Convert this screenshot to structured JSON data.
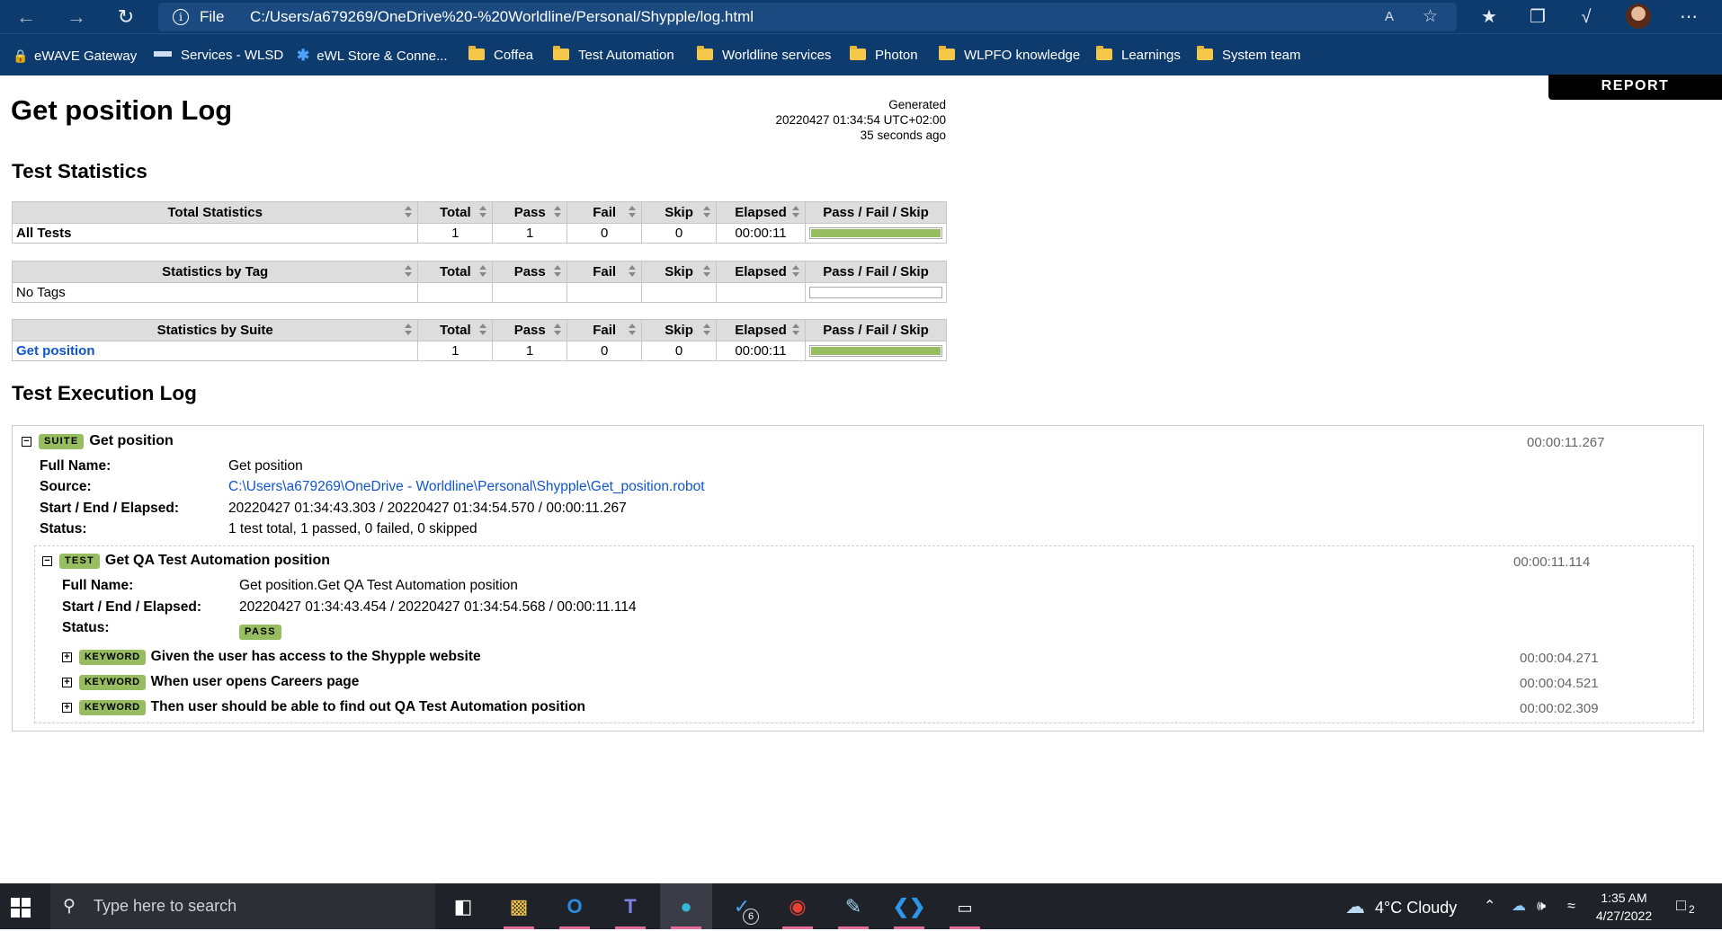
{
  "browser": {
    "address": {
      "scheme": "File",
      "url": "C:/Users/a679269/OneDrive%20-%20Worldline/Personal/Shypple/log.html"
    },
    "read_aloud": "A",
    "bookmarks": [
      {
        "label": "eWAVE Gateway",
        "icon": "lock-icon"
      },
      {
        "label": "Services - WLSD",
        "icon": "wlsd-icon"
      },
      {
        "label": "eWL Store & Conne...",
        "icon": "ewl-icon"
      },
      {
        "label": "Coffea",
        "icon": "folder-icon"
      },
      {
        "label": "Test Automation",
        "icon": "folder-icon"
      },
      {
        "label": "Worldline services",
        "icon": "folder-icon"
      },
      {
        "label": "Photon",
        "icon": "folder-icon"
      },
      {
        "label": "WLPFO knowledge",
        "icon": "folder-icon"
      },
      {
        "label": "Learnings",
        "icon": "folder-icon"
      },
      {
        "label": "System team",
        "icon": "folder-icon"
      }
    ]
  },
  "page": {
    "report_link": "REPORT",
    "title": "Get position Log",
    "generated": {
      "label": "Generated",
      "timestamp": "20220427 01:34:54 UTC+02:00",
      "ago": "35 seconds ago"
    },
    "stats_title": "Test Statistics",
    "columns": [
      "Total",
      "Pass",
      "Fail",
      "Skip",
      "Elapsed",
      "Pass / Fail / Skip"
    ],
    "total_stats": {
      "header": "Total Statistics",
      "row": {
        "name": "All Tests",
        "total": "1",
        "pass": "1",
        "fail": "0",
        "skip": "0",
        "elapsed": "00:00:11",
        "pass_ratio": 1
      }
    },
    "tag_stats": {
      "header": "Statistics by Tag",
      "row": {
        "name": "No Tags",
        "total": "",
        "pass": "",
        "fail": "",
        "skip": "",
        "elapsed": "",
        "pass_ratio": 0
      }
    },
    "suite_stats": {
      "header": "Statistics by Suite",
      "row": {
        "name": "Get position",
        "total": "1",
        "pass": "1",
        "fail": "0",
        "skip": "0",
        "elapsed": "00:00:11",
        "pass_ratio": 1
      }
    },
    "log_title": "Test Execution Log",
    "suite": {
      "label": "SUITE",
      "name": "Get position",
      "elapsed": "00:00:11.267",
      "meta": {
        "full_name_key": "Full Name:",
        "full_name": "Get position",
        "source_key": "Source:",
        "source": "C:\\Users\\a679269\\OneDrive - Worldline\\Personal\\Shypple\\Get_position.robot",
        "times_key": "Start / End / Elapsed:",
        "times": "20220427 01:34:43.303 / 20220427 01:34:54.570 / 00:00:11.267",
        "status_key": "Status:",
        "status": "1 test total, 1 passed, 0 failed, 0 skipped"
      },
      "test": {
        "label": "TEST",
        "name": "Get QA Test Automation position",
        "elapsed": "00:00:11.114",
        "meta": {
          "full_name_key": "Full Name:",
          "full_name": "Get position.Get QA Test Automation position",
          "times_key": "Start / End / Elapsed:",
          "times": "20220427 01:34:43.454 / 20220427 01:34:54.568 / 00:00:11.114",
          "status_key": "Status:",
          "status": "PASS"
        },
        "keywords": [
          {
            "label": "KEYWORD",
            "name": "Given the user has access to the Shypple website",
            "elapsed": "00:00:04.271"
          },
          {
            "label": "KEYWORD",
            "name": "When user opens Careers page",
            "elapsed": "00:00:04.521"
          },
          {
            "label": "KEYWORD",
            "name": "Then user should be able to find out QA Test Automation position",
            "elapsed": "00:00:02.309"
          }
        ]
      }
    }
  },
  "taskbar": {
    "search_placeholder": "Type here to search",
    "todo_badge": "6",
    "weather": "4°C  Cloudy",
    "time": "1:35 AM",
    "date": "4/27/2022",
    "notifications": "2"
  },
  "colors": {
    "chrome": "#0d3b6e",
    "pass": "#97bd61",
    "link": "#1155cc",
    "taskbar": "#1f2229"
  }
}
